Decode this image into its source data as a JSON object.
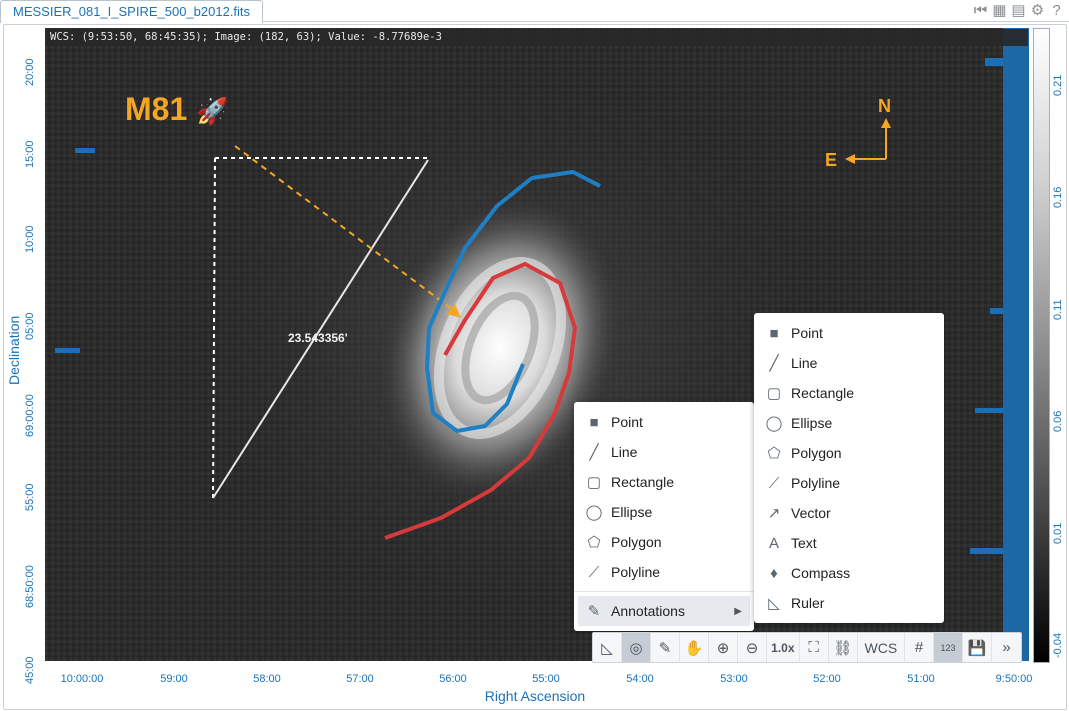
{
  "tab": {
    "title": "MESSIER_081_I_SPIRE_500_b2012.fits"
  },
  "readout": "WCS: (9:53:50, 68:45:35); Image: (182, 63); Value: -8.77689e-3",
  "axes": {
    "ylabel": "Declination",
    "xlabel": "Right Ascension",
    "yticks": [
      "20:00",
      "15:00",
      "10:00",
      "05:00",
      "69:00:00",
      "55:00",
      "68:50:00",
      "45:00"
    ],
    "xticks": [
      "10:00:00",
      "59:00",
      "58:00",
      "57:00",
      "56:00",
      "55:00",
      "54:00",
      "53:00",
      "52:00",
      "51:00",
      "9:50:00"
    ]
  },
  "colorbar": {
    "ticks": [
      "0.21",
      "0.16",
      "0.11",
      "0.06",
      "0.01",
      "-0.04"
    ]
  },
  "annotations": {
    "target_label": "M81",
    "target_emoji": "🚀",
    "ruler_value": "23.543356'",
    "compass_n": "N",
    "compass_e": "E"
  },
  "colors": {
    "accent": "#1a73b8",
    "annotation": "#f5a623",
    "arm_blue": "#1f7fc4",
    "arm_red": "#d73a3a"
  },
  "menu_main": {
    "items": [
      {
        "label": "Point",
        "icon": "point-icon"
      },
      {
        "label": "Line",
        "icon": "line-icon"
      },
      {
        "label": "Rectangle",
        "icon": "rectangle-icon"
      },
      {
        "label": "Ellipse",
        "icon": "ellipse-icon"
      },
      {
        "label": "Polygon",
        "icon": "polygon-icon"
      },
      {
        "label": "Polyline",
        "icon": "polyline-icon"
      }
    ],
    "submenu_label": "Annotations"
  },
  "menu_annotations": {
    "items": [
      {
        "label": "Point"
      },
      {
        "label": "Line"
      },
      {
        "label": "Rectangle"
      },
      {
        "label": "Ellipse"
      },
      {
        "label": "Polygon"
      },
      {
        "label": "Polyline"
      },
      {
        "label": "Vector"
      },
      {
        "label": "Text"
      },
      {
        "label": "Compass"
      },
      {
        "label": "Ruler"
      }
    ]
  },
  "toolbar": {
    "zoom_level": "1.0x",
    "coord_system": "WCS",
    "pixel_label": "123"
  }
}
